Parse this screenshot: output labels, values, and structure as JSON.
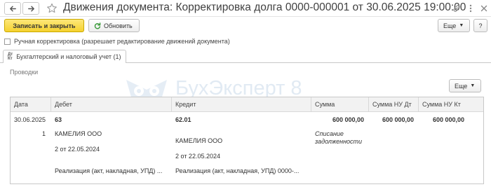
{
  "window": {
    "title": "Движения документа: Корректировка долга 0000-000001 от 30.06.2025 19:00:00"
  },
  "toolbar": {
    "save_close_label": "Записать и закрыть",
    "refresh_label": "Обновить",
    "more_label": "Еще",
    "help_label": "?"
  },
  "manual_correction": {
    "label": "Ручная корректировка (разрешает редактирование движений документа)",
    "checked": false
  },
  "tabs": [
    {
      "label": "Бухгалтерский и налоговый учет (1)"
    }
  ],
  "section": {
    "title": "Проводки",
    "more_label": "Еще"
  },
  "watermark": {
    "text": "БухЭксперт 8"
  },
  "table": {
    "columns": {
      "date": "Дата",
      "debit": "Дебет",
      "credit": "Кредит",
      "sum": "Сумма",
      "sum_nu_dt": "Сумма НУ Дт",
      "sum_nu_kt": "Сумма НУ Кт"
    },
    "rows": [
      {
        "date": "30.06.2025",
        "line_no": "1",
        "debit_account": "63",
        "debit_subconto1": "КАМЕЛИЯ ООО",
        "debit_subconto2": "2 от 22.05.2024",
        "debit_subconto3": "Реализация (акт, накладная, УПД) ...",
        "credit_account": "62.01",
        "credit_subconto1": "КАМЕЛИЯ ООО",
        "credit_subconto2": "2 от 22.05.2024",
        "credit_subconto3": "Реализация (акт, накладная, УПД) 0000-...",
        "sum": "600 000,00",
        "content_line1": "Списание",
        "content_line2": "задолженности",
        "sum_nu_dt": "600 000,00",
        "sum_nu_kt": "600 000,00"
      }
    ]
  }
}
